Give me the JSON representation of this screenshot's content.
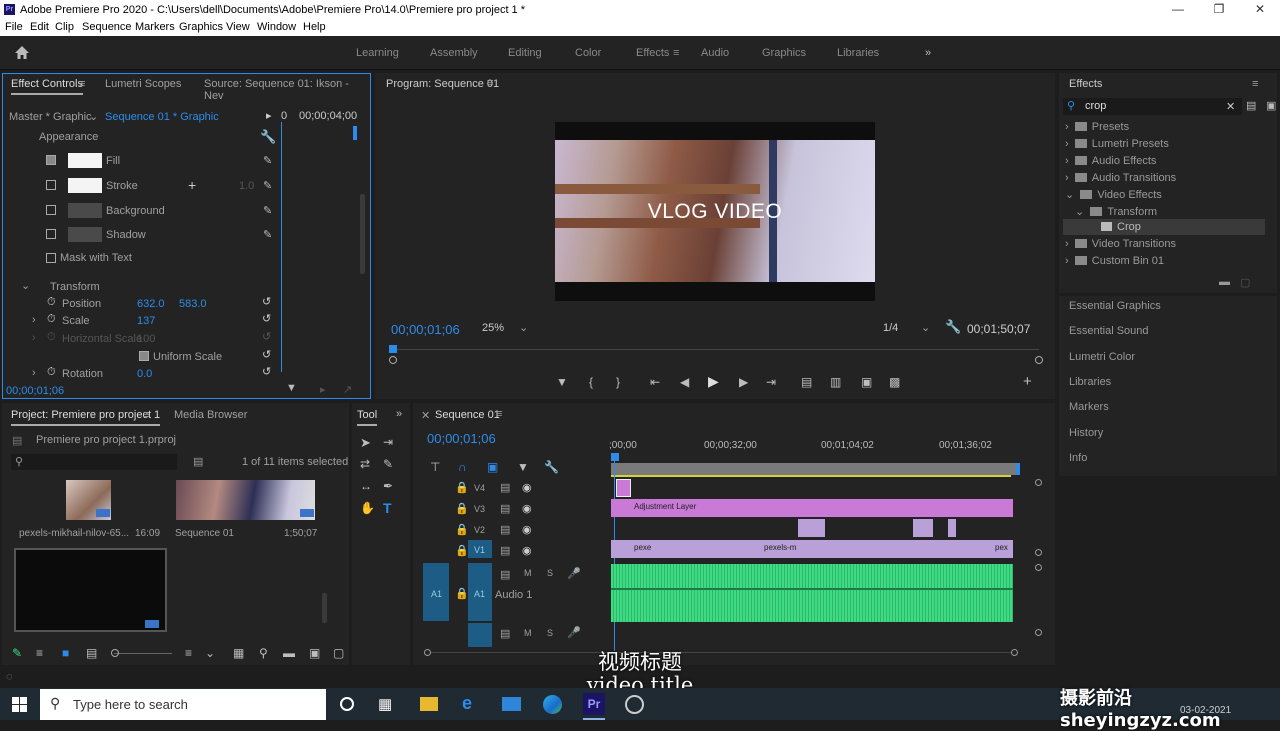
{
  "window": {
    "title": "Adobe Premiere Pro 2020 - C:\\Users\\dell\\Documents\\Adobe\\Premiere Pro\\14.0\\Premiere pro project 1 *"
  },
  "menu": [
    "File",
    "Edit",
    "Clip",
    "Sequence",
    "Markers",
    "Graphics",
    "View",
    "Window",
    "Help"
  ],
  "workspaces": [
    "Learning",
    "Assembly",
    "Editing",
    "Color",
    "Effects",
    "Audio",
    "Graphics",
    "Libraries"
  ],
  "active_workspace": "Effects",
  "effect_controls": {
    "tabs": [
      "Effect Controls",
      "Lumetri Scopes",
      "Source: Sequence 01: Ikson - Nev"
    ],
    "master": "Master * Graphic",
    "sequence": "Sequence 01 * Graphic",
    "ruler_start": "0",
    "ruler_time": "00;00;04;00",
    "appearance": "Appearance",
    "fill": "Fill",
    "stroke": "Stroke",
    "stroke_width": "1.0",
    "background": "Background",
    "shadow": "Shadow",
    "mask_with_text": "Mask with Text",
    "transform": "Transform",
    "position_label": "Position",
    "position_x": "632.0",
    "position_y": "583.0",
    "scale_label": "Scale",
    "scale_value": "137",
    "hscale_label": "Horizontal Scale",
    "hscale_value": "100",
    "uniform_scale": "Uniform Scale",
    "rotation_label": "Rotation",
    "rotation_value": "0.0",
    "timecode": "00;00;01;06"
  },
  "program": {
    "title": "Program: Sequence 01",
    "overlay_text": "VLOG VIDEO",
    "timecode": "00;00;01;06",
    "zoom": "25%",
    "quality": "1/4",
    "duration": "00;01;50;07"
  },
  "effects_panel": {
    "title": "Effects",
    "search_value": "crop",
    "tree": [
      "Presets",
      "Lumetri Presets",
      "Audio Effects",
      "Audio Transitions",
      "Video Effects",
      "Transform",
      "Crop",
      "Video Transitions",
      "Custom Bin 01"
    ],
    "links": [
      "Essential Graphics",
      "Essential Sound",
      "Lumetri Color",
      "Libraries",
      "Markers",
      "History",
      "Info"
    ]
  },
  "project": {
    "tabs": [
      "Project: Premiere pro project 1",
      "Media Browser"
    ],
    "file": "Premiere pro project 1.prproj",
    "selected": "1 of 11 items selected",
    "items": [
      {
        "name": "pexels-mikhail-nilov-65...",
        "duration": "16:09"
      },
      {
        "name": "Sequence 01",
        "duration": "1;50;07"
      }
    ]
  },
  "tools": {
    "title": "Tool"
  },
  "timeline": {
    "title": "Sequence 01",
    "timecode": "00;00;01;06",
    "ruler": [
      ";00;00",
      "00;00;32;00",
      "00;01;04;02",
      "00;01;36;02"
    ],
    "tracks": [
      "V4",
      "V3",
      "V2",
      "V1",
      "A1"
    ],
    "adjustment_layer": "Adjustment Layer",
    "clip_label_1": "pexe",
    "clip_label_2": "pexels-m",
    "clip_label_3": "pex",
    "audio_label": "Audio 1",
    "track_m": "M",
    "track_s": "S"
  },
  "subtitles": {
    "zh": "视频标题",
    "en": "video title"
  },
  "watermark": "摄影前沿 sheyingzyz.com",
  "taskbar": {
    "search": "Type here to search",
    "date": "03-02-2021"
  },
  "colors": {
    "accent": "#2d8ceb",
    "clip_purple": "#c97ad6",
    "audio_green": "#3ddc84"
  }
}
